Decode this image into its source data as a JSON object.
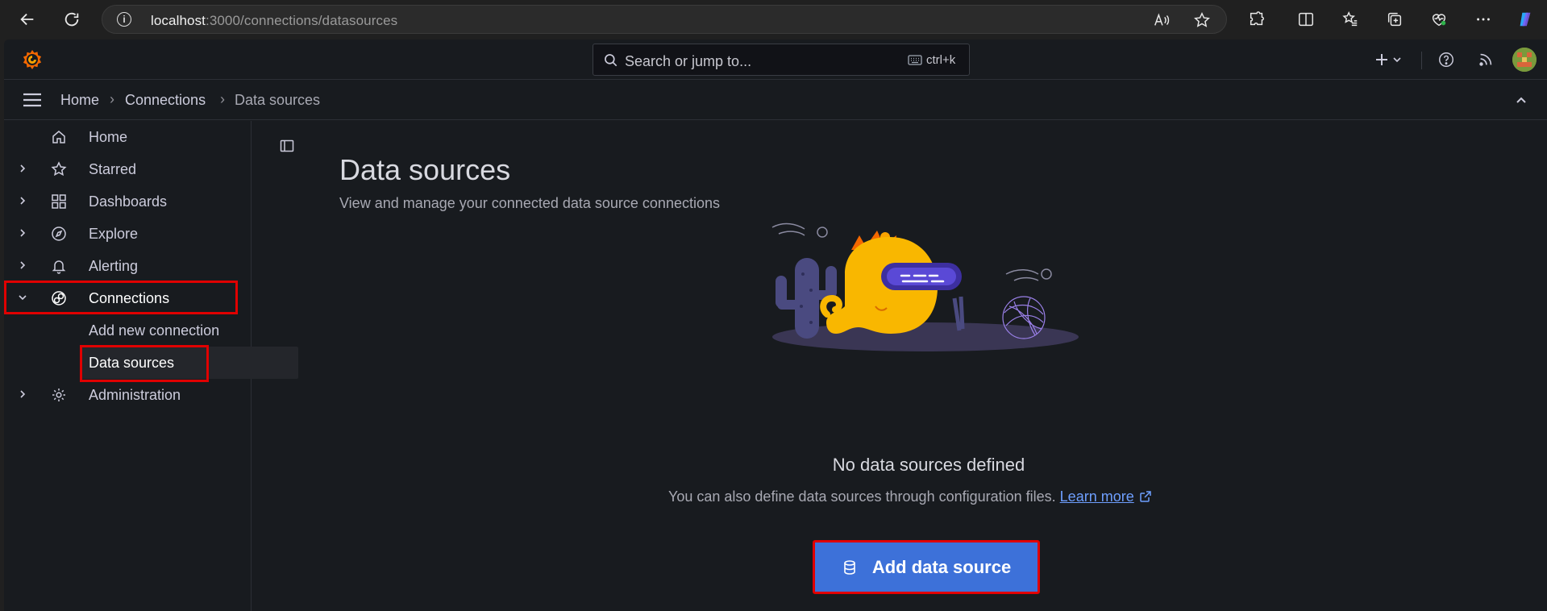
{
  "browser": {
    "url_host": "localhost",
    "url_path": ":3000/connections/datasources"
  },
  "topbar": {
    "search_placeholder": "Search or jump to...",
    "search_shortcut": "ctrl+k"
  },
  "breadcrumb": {
    "items": [
      "Home",
      "Connections",
      "Data sources"
    ]
  },
  "sidebar": {
    "items": [
      {
        "label": "Home",
        "icon": "home-icon"
      },
      {
        "label": "Starred",
        "icon": "star-icon"
      },
      {
        "label": "Dashboards",
        "icon": "dashboards-icon"
      },
      {
        "label": "Explore",
        "icon": "compass-icon"
      },
      {
        "label": "Alerting",
        "icon": "bell-icon"
      },
      {
        "label": "Connections",
        "icon": "connections-icon"
      },
      {
        "label": "Add new connection"
      },
      {
        "label": "Data sources"
      },
      {
        "label": "Administration",
        "icon": "gear-icon"
      }
    ]
  },
  "main": {
    "title": "Data sources",
    "subtitle": "View and manage your connected data source connections",
    "empty_title": "No data sources defined",
    "empty_text": "You can also define data sources through configuration files.",
    "learn_more": "Learn more",
    "add_button": "Add data source"
  },
  "colors": {
    "accent": "#3d71d9",
    "link": "#6e9fff",
    "highlight": "#e00000",
    "background": "#181b1f"
  }
}
